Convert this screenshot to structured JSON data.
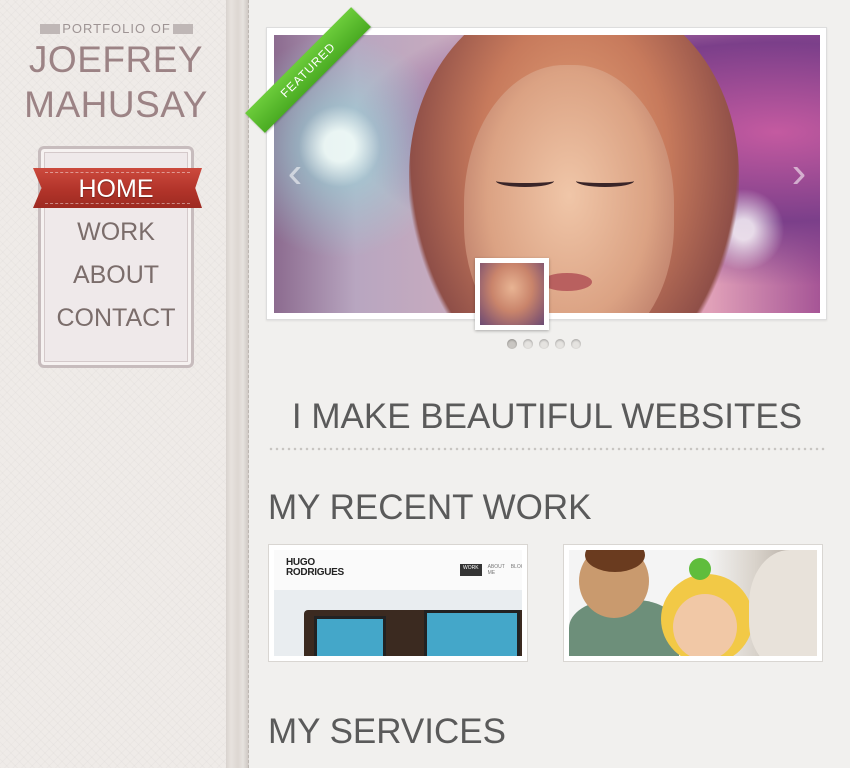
{
  "sidebar": {
    "kicker": "PORTFOLIO OF",
    "name_line1": "JOEFREY",
    "name_line2": "MAHUSAY",
    "nav": [
      {
        "label": "HOME",
        "active": true
      },
      {
        "label": "WORK",
        "active": false
      },
      {
        "label": "ABOUT",
        "active": false
      },
      {
        "label": "CONTACT",
        "active": false
      }
    ]
  },
  "slider": {
    "badge": "FEATURED",
    "prev_icon": "chevron-left-icon",
    "next_icon": "chevron-right-icon",
    "slide_count": 5,
    "active_slide": 1
  },
  "tagline": "I MAKE BEAUTIFUL WEBSITES",
  "recent_work": {
    "heading": "MY RECENT WORK",
    "items": [
      {
        "brand_line1": "HUGO",
        "brand_line2": "RODRIGUES",
        "nav": [
          "WORK",
          "ABOUT ME",
          "BLOG"
        ]
      },
      {
        "type": "illustration"
      }
    ]
  },
  "services": {
    "heading": "MY SERVICES"
  },
  "colors": {
    "accent_red": "#b2342a",
    "featured_green": "#4aab22",
    "name_color": "#9c8385"
  }
}
